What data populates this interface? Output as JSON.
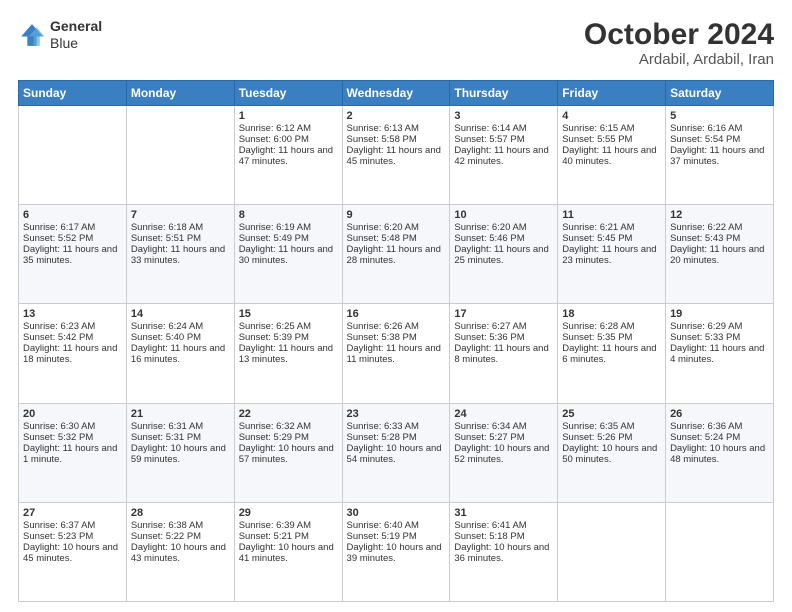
{
  "header": {
    "logo_line1": "General",
    "logo_line2": "Blue",
    "title": "October 2024",
    "subtitle": "Ardabil, Ardabil, Iran"
  },
  "days_of_week": [
    "Sunday",
    "Monday",
    "Tuesday",
    "Wednesday",
    "Thursday",
    "Friday",
    "Saturday"
  ],
  "weeks": [
    [
      {
        "day": "",
        "sunrise": "",
        "sunset": "",
        "daylight": ""
      },
      {
        "day": "",
        "sunrise": "",
        "sunset": "",
        "daylight": ""
      },
      {
        "day": "1",
        "sunrise": "Sunrise: 6:12 AM",
        "sunset": "Sunset: 6:00 PM",
        "daylight": "Daylight: 11 hours and 47 minutes."
      },
      {
        "day": "2",
        "sunrise": "Sunrise: 6:13 AM",
        "sunset": "Sunset: 5:58 PM",
        "daylight": "Daylight: 11 hours and 45 minutes."
      },
      {
        "day": "3",
        "sunrise": "Sunrise: 6:14 AM",
        "sunset": "Sunset: 5:57 PM",
        "daylight": "Daylight: 11 hours and 42 minutes."
      },
      {
        "day": "4",
        "sunrise": "Sunrise: 6:15 AM",
        "sunset": "Sunset: 5:55 PM",
        "daylight": "Daylight: 11 hours and 40 minutes."
      },
      {
        "day": "5",
        "sunrise": "Sunrise: 6:16 AM",
        "sunset": "Sunset: 5:54 PM",
        "daylight": "Daylight: 11 hours and 37 minutes."
      }
    ],
    [
      {
        "day": "6",
        "sunrise": "Sunrise: 6:17 AM",
        "sunset": "Sunset: 5:52 PM",
        "daylight": "Daylight: 11 hours and 35 minutes."
      },
      {
        "day": "7",
        "sunrise": "Sunrise: 6:18 AM",
        "sunset": "Sunset: 5:51 PM",
        "daylight": "Daylight: 11 hours and 33 minutes."
      },
      {
        "day": "8",
        "sunrise": "Sunrise: 6:19 AM",
        "sunset": "Sunset: 5:49 PM",
        "daylight": "Daylight: 11 hours and 30 minutes."
      },
      {
        "day": "9",
        "sunrise": "Sunrise: 6:20 AM",
        "sunset": "Sunset: 5:48 PM",
        "daylight": "Daylight: 11 hours and 28 minutes."
      },
      {
        "day": "10",
        "sunrise": "Sunrise: 6:20 AM",
        "sunset": "Sunset: 5:46 PM",
        "daylight": "Daylight: 11 hours and 25 minutes."
      },
      {
        "day": "11",
        "sunrise": "Sunrise: 6:21 AM",
        "sunset": "Sunset: 5:45 PM",
        "daylight": "Daylight: 11 hours and 23 minutes."
      },
      {
        "day": "12",
        "sunrise": "Sunrise: 6:22 AM",
        "sunset": "Sunset: 5:43 PM",
        "daylight": "Daylight: 11 hours and 20 minutes."
      }
    ],
    [
      {
        "day": "13",
        "sunrise": "Sunrise: 6:23 AM",
        "sunset": "Sunset: 5:42 PM",
        "daylight": "Daylight: 11 hours and 18 minutes."
      },
      {
        "day": "14",
        "sunrise": "Sunrise: 6:24 AM",
        "sunset": "Sunset: 5:40 PM",
        "daylight": "Daylight: 11 hours and 16 minutes."
      },
      {
        "day": "15",
        "sunrise": "Sunrise: 6:25 AM",
        "sunset": "Sunset: 5:39 PM",
        "daylight": "Daylight: 11 hours and 13 minutes."
      },
      {
        "day": "16",
        "sunrise": "Sunrise: 6:26 AM",
        "sunset": "Sunset: 5:38 PM",
        "daylight": "Daylight: 11 hours and 11 minutes."
      },
      {
        "day": "17",
        "sunrise": "Sunrise: 6:27 AM",
        "sunset": "Sunset: 5:36 PM",
        "daylight": "Daylight: 11 hours and 8 minutes."
      },
      {
        "day": "18",
        "sunrise": "Sunrise: 6:28 AM",
        "sunset": "Sunset: 5:35 PM",
        "daylight": "Daylight: 11 hours and 6 minutes."
      },
      {
        "day": "19",
        "sunrise": "Sunrise: 6:29 AM",
        "sunset": "Sunset: 5:33 PM",
        "daylight": "Daylight: 11 hours and 4 minutes."
      }
    ],
    [
      {
        "day": "20",
        "sunrise": "Sunrise: 6:30 AM",
        "sunset": "Sunset: 5:32 PM",
        "daylight": "Daylight: 11 hours and 1 minute."
      },
      {
        "day": "21",
        "sunrise": "Sunrise: 6:31 AM",
        "sunset": "Sunset: 5:31 PM",
        "daylight": "Daylight: 10 hours and 59 minutes."
      },
      {
        "day": "22",
        "sunrise": "Sunrise: 6:32 AM",
        "sunset": "Sunset: 5:29 PM",
        "daylight": "Daylight: 10 hours and 57 minutes."
      },
      {
        "day": "23",
        "sunrise": "Sunrise: 6:33 AM",
        "sunset": "Sunset: 5:28 PM",
        "daylight": "Daylight: 10 hours and 54 minutes."
      },
      {
        "day": "24",
        "sunrise": "Sunrise: 6:34 AM",
        "sunset": "Sunset: 5:27 PM",
        "daylight": "Daylight: 10 hours and 52 minutes."
      },
      {
        "day": "25",
        "sunrise": "Sunrise: 6:35 AM",
        "sunset": "Sunset: 5:26 PM",
        "daylight": "Daylight: 10 hours and 50 minutes."
      },
      {
        "day": "26",
        "sunrise": "Sunrise: 6:36 AM",
        "sunset": "Sunset: 5:24 PM",
        "daylight": "Daylight: 10 hours and 48 minutes."
      }
    ],
    [
      {
        "day": "27",
        "sunrise": "Sunrise: 6:37 AM",
        "sunset": "Sunset: 5:23 PM",
        "daylight": "Daylight: 10 hours and 45 minutes."
      },
      {
        "day": "28",
        "sunrise": "Sunrise: 6:38 AM",
        "sunset": "Sunset: 5:22 PM",
        "daylight": "Daylight: 10 hours and 43 minutes."
      },
      {
        "day": "29",
        "sunrise": "Sunrise: 6:39 AM",
        "sunset": "Sunset: 5:21 PM",
        "daylight": "Daylight: 10 hours and 41 minutes."
      },
      {
        "day": "30",
        "sunrise": "Sunrise: 6:40 AM",
        "sunset": "Sunset: 5:19 PM",
        "daylight": "Daylight: 10 hours and 39 minutes."
      },
      {
        "day": "31",
        "sunrise": "Sunrise: 6:41 AM",
        "sunset": "Sunset: 5:18 PM",
        "daylight": "Daylight: 10 hours and 36 minutes."
      },
      {
        "day": "",
        "sunrise": "",
        "sunset": "",
        "daylight": ""
      },
      {
        "day": "",
        "sunrise": "",
        "sunset": "",
        "daylight": ""
      }
    ]
  ]
}
